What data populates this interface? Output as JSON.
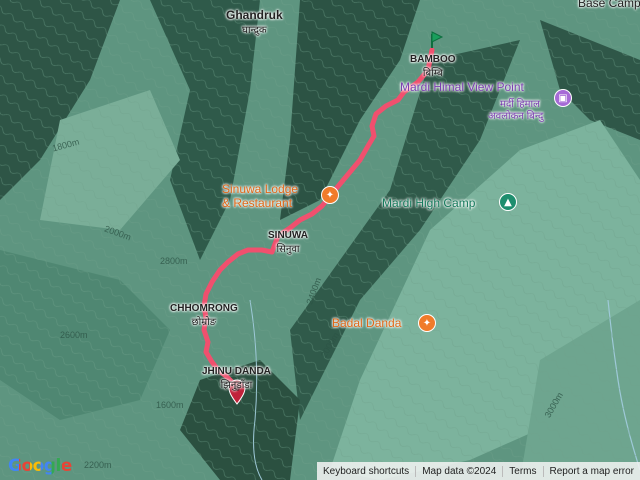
{
  "places": {
    "ghandruk": {
      "name": "Ghandruk",
      "native": "घान्द्रुक"
    },
    "bamboo": {
      "name": "BAMBOO",
      "native": "बिम्बि"
    },
    "sinuwa": {
      "name": "SINUWA",
      "native": "सिनुवा"
    },
    "chhomrong": {
      "name": "CHHOMRONG",
      "native": "छोम्रोङ"
    },
    "jhinu_danda": {
      "name": "JHINU DANDA",
      "native": "झिनुडाँडा"
    },
    "base_camp": {
      "name": "Base Camp"
    }
  },
  "pois": {
    "mardi_view": {
      "name": "Mardi Himal View Point",
      "native_line1": "मर्दी हिमाल",
      "native_line2": "अवलोकन बिन्दु",
      "icon": "camera-icon",
      "color": "#a66bd6"
    },
    "sinuwa_lodge": {
      "line1": "Sinuwa Lodge",
      "line2": "& Restaurant",
      "icon": "restaurant-icon",
      "color": "#f07b2a"
    },
    "mardi_high_camp": {
      "name": "Mardi High Camp",
      "icon": "camp-icon",
      "color": "#1e8e6e"
    },
    "badal_danda": {
      "name": "Badal Danda",
      "icon": "restaurant-icon",
      "color": "#f07b2a"
    }
  },
  "route": {
    "color": "#f0506e",
    "start_marker_color": "#1a9e5c",
    "end_marker_color": "#c0223a"
  },
  "contours": [
    "1800m",
    "2000m",
    "2400m",
    "2600m",
    "2800m",
    "3000m",
    "2200m",
    "1600m",
    "2000m"
  ],
  "footer": {
    "shortcuts": "Keyboard shortcuts",
    "map_data": "Map data ©2024",
    "terms": "Terms",
    "report": "Report a map error"
  },
  "logo": {
    "text": "Google"
  }
}
